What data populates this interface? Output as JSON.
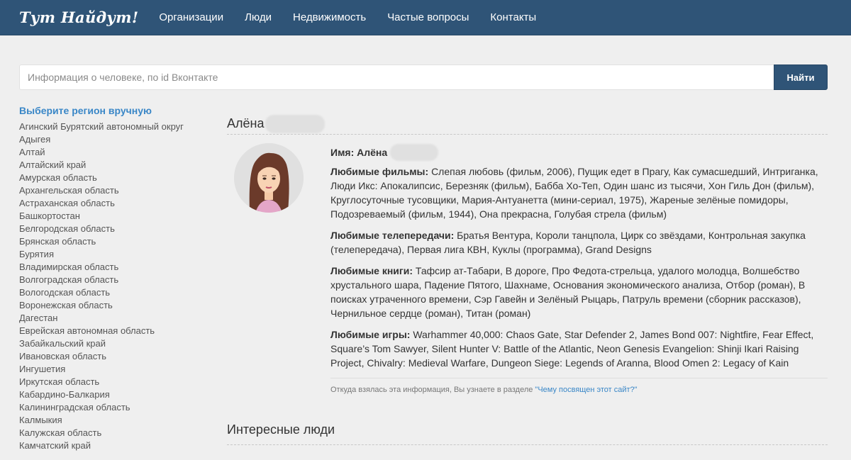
{
  "nav": {
    "brand": "Тут Найдут!",
    "items": [
      "Организации",
      "Люди",
      "Недвижимость",
      "Частые вопросы",
      "Контакты"
    ]
  },
  "search": {
    "placeholder": "Информация о человеке, по id Вконтакте",
    "button_label": "Найти"
  },
  "sidebar": {
    "title": "Выберите регион вручную",
    "regions": [
      "Агинский Бурятский автономный округ",
      "Адыгея",
      "Алтай",
      "Алтайский край",
      "Амурская область",
      "Архангельская область",
      "Астраханская область",
      "Башкортостан",
      "Белгородская область",
      "Брянская область",
      "Бурятия",
      "Владимирская область",
      "Волгоградская область",
      "Вологодская область",
      "Воронежская область",
      "Дагестан",
      "Еврейская автономная область",
      "Забайкальский край",
      "Ивановская область",
      "Ингушетия",
      "Иркутская область",
      "Кабардино-Балкария",
      "Калининградская область",
      "Калмыкия",
      "Калужская область",
      "Камчатский край"
    ]
  },
  "person": {
    "header_name": "Алёна",
    "name_label": "Имя:",
    "name_value": "Алёна",
    "fields": [
      {
        "label": "Любимые фильмы:",
        "value": "Слепая любовь (фильм, 2006), Пущик едет в Прагу, Как сумасшедший, Интриганка, Люди Икс: Апокалипсис, Березняк (фильм), Бабба Хо-Теп, Один шанс из тысячи, Хон Гиль Дон (фильм), Круглосуточные тусовщики, Мария-Антуанетта (мини-сериал, 1975), Жареные зелёные помидоры, Подозреваемый (фильм, 1944), Она прекрасна, Голубая стрела (фильм)"
      },
      {
        "label": "Любимые телепередачи:",
        "value": "Братья Вентура, Короли танцпола, Цирк со звёздами, Контрольная закупка (телепередача), Первая лига КВН, Куклы (программа), Grand Designs"
      },
      {
        "label": "Любимые книги:",
        "value": "Тафсир ат-Табари, В дороге, Про Федота-стрельца, удалого молодца, Волшебство хрустального шара, Падение Пятого, Шахнаме, Основания экономического анализа, Отбор (роман), В поисках утраченного времени, Сэр Гавейн и Зелёный Рыцарь, Патруль времени (сборник рассказов), Чернильное сердце (роман), Титан (роман)"
      },
      {
        "label": "Любимые игры:",
        "value": "Warhammer 40,000: Chaos Gate, Star Defender 2, James Bond 007: Nightfire, Fear Effect, Square’s Tom Sawyer, Silent Hunter V: Battle of the Atlantic, Neon Genesis Evangelion: Shinji Ikari Raising Project, Chivalry: Medieval Warfare, Dungeon Siege: Legends of Aranna, Blood Omen 2: Legacy of Kain"
      }
    ],
    "note_text": "Откуда взялась эта информация, Вы узнаете в разделе ",
    "note_link": "\"Чему посвящен этот сайт?\""
  },
  "interesting_title": "Интересные люди",
  "colors": {
    "navbar": "#2f5477",
    "accent": "#3a87c7",
    "background": "#efefef"
  }
}
